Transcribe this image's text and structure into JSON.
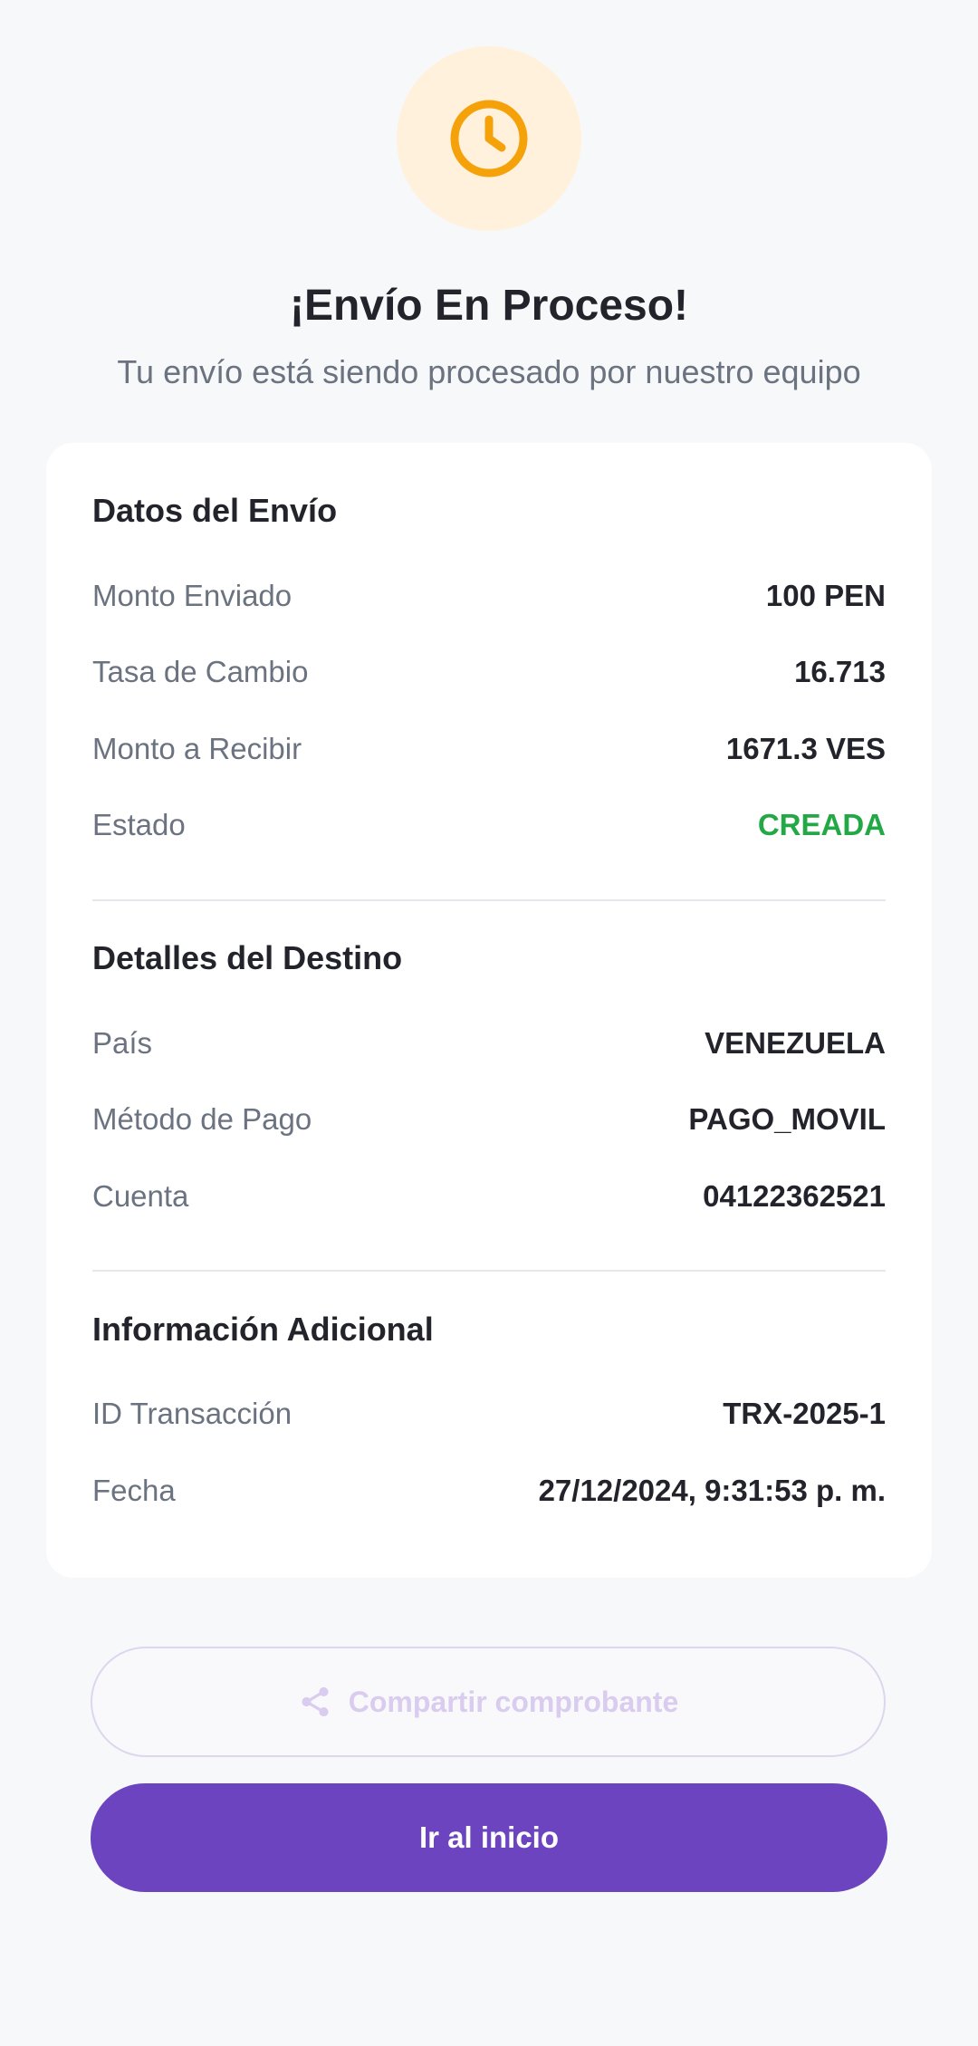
{
  "header": {
    "icon": "clock-icon",
    "accent_color": "#f5a20a",
    "title": "¡Envío En Proceso!",
    "subtitle": "Tu envío está siendo procesado por nuestro equipo"
  },
  "shipment": {
    "title": "Datos del Envío",
    "rows": [
      {
        "label": "Monto Enviado",
        "value": "100 PEN"
      },
      {
        "label": "Tasa de Cambio",
        "value": "16.713"
      },
      {
        "label": "Monto a Recibir",
        "value": "1671.3 VES"
      },
      {
        "label": "Estado",
        "value": "CREADA",
        "color": "#22a845"
      }
    ]
  },
  "destination": {
    "title": "Detalles del Destino",
    "rows": [
      {
        "label": "País",
        "value": "VENEZUELA"
      },
      {
        "label": "Método de Pago",
        "value": "PAGO_MOVIL"
      },
      {
        "label": "Cuenta",
        "value": "04122362521"
      }
    ]
  },
  "additional": {
    "title": "Información Adicional",
    "rows": [
      {
        "label": "ID Transacción",
        "value": "TRX-2025-1"
      },
      {
        "label": "Fecha",
        "value": "27/12/2024, 9:31:53 p. m."
      }
    ]
  },
  "actions": {
    "share_label": "Compartir comprobante",
    "share_icon": "share-icon",
    "home_label": "Ir al inicio",
    "primary_color": "#6d44bf"
  }
}
